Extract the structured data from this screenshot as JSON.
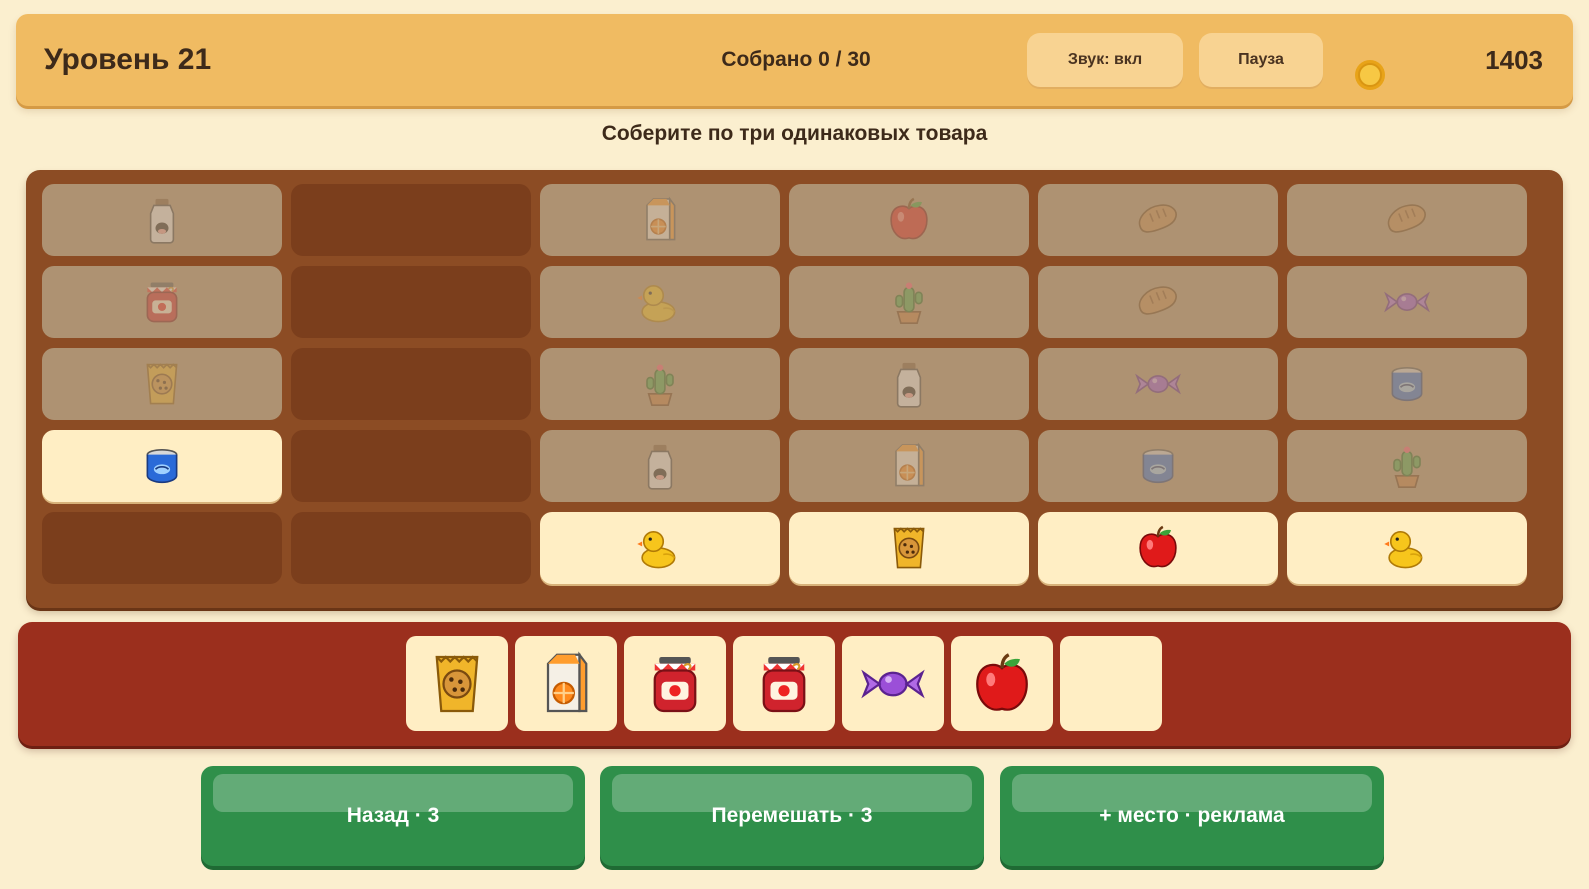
{
  "header": {
    "level_label": "Уровень 21",
    "collected_label": "Собрано 0 / 30",
    "sound_label": "Звук: вкл",
    "pause_label": "Пауза",
    "coin_icon": "coin-icon",
    "coins": "1403"
  },
  "instruction": "Соберите по три одинаковых товара",
  "board": {
    "columns": 6,
    "rows": 5,
    "cells": [
      [
        {
          "item": "milk",
          "state": "blocked"
        },
        {
          "item": null,
          "state": "empty"
        },
        {
          "item": "juice",
          "state": "blocked"
        },
        {
          "item": "apple",
          "state": "blocked"
        },
        {
          "item": "bread",
          "state": "blocked"
        },
        {
          "item": "bread",
          "state": "blocked"
        }
      ],
      [
        {
          "item": "jam",
          "state": "blocked"
        },
        {
          "item": null,
          "state": "empty"
        },
        {
          "item": "duck",
          "state": "blocked"
        },
        {
          "item": "cactus",
          "state": "blocked"
        },
        {
          "item": "bread",
          "state": "blocked"
        },
        {
          "item": "candy",
          "state": "blocked"
        }
      ],
      [
        {
          "item": "cookies",
          "state": "blocked"
        },
        {
          "item": null,
          "state": "empty"
        },
        {
          "item": "cactus",
          "state": "blocked"
        },
        {
          "item": "milk",
          "state": "blocked"
        },
        {
          "item": "candy",
          "state": "blocked"
        },
        {
          "item": "can",
          "state": "blocked"
        }
      ],
      [
        {
          "item": "can",
          "state": "active"
        },
        {
          "item": null,
          "state": "empty"
        },
        {
          "item": "milk",
          "state": "blocked"
        },
        {
          "item": "juice",
          "state": "blocked"
        },
        {
          "item": "can",
          "state": "blocked"
        },
        {
          "item": "cactus",
          "state": "blocked"
        }
      ],
      [
        {
          "item": null,
          "state": "empty"
        },
        {
          "item": null,
          "state": "empty"
        },
        {
          "item": "duck",
          "state": "active"
        },
        {
          "item": "cookies",
          "state": "active"
        },
        {
          "item": "apple",
          "state": "active"
        },
        {
          "item": "duck",
          "state": "active"
        }
      ]
    ]
  },
  "tray": {
    "capacity": 7,
    "items": [
      "cookies",
      "juice",
      "jam",
      "jam",
      "candy",
      "apple"
    ]
  },
  "actions": {
    "undo_label": "Назад · 3",
    "shuffle_label": "Перемешать · 3",
    "extra_slot_label": "+ место · реклама"
  },
  "colors": {
    "header_bg": "#f0bb62",
    "page_bg": "#fbefcf",
    "board_bg": "#8c4c24",
    "tray_bg": "#9b2f1d",
    "button_green": "#2f8f4a"
  }
}
